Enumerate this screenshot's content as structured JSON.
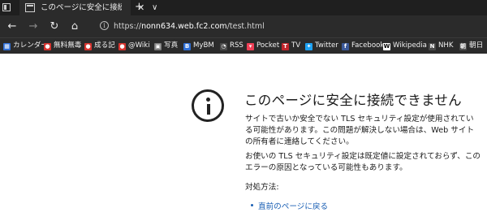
{
  "tab": {
    "title": "このページに安全に接続できま",
    "close": "✕"
  },
  "tabstrip": {
    "new_tab": "+",
    "tab_list": "∨"
  },
  "nav": {
    "back": "←",
    "forward": "→",
    "refresh": "↻",
    "home": "⌂"
  },
  "address": {
    "scheme": "https://",
    "host": "nonn634.web.fc2.com",
    "path": "/test.html"
  },
  "favorites": [
    {
      "label": "カレンダー",
      "icon": "calendar-icon",
      "color": "#2f6fd6"
    },
    {
      "label": "無料無毒",
      "icon": "site-icon",
      "color": "#d6342f"
    },
    {
      "label": "成る記",
      "icon": "site-icon",
      "color": "#d6342f"
    },
    {
      "label": "@Wiki",
      "icon": "wiki-icon",
      "color": "#d6342f"
    },
    {
      "label": "写真",
      "icon": "photos-icon",
      "color": "#7a7a7a"
    },
    {
      "label": "MyBM",
      "icon": "bookmark-icon",
      "color": "#2f6fd6"
    },
    {
      "label": "RSS",
      "icon": "rss-icon",
      "color": "#4a4a4a"
    },
    {
      "label": "Pocket",
      "icon": "pocket-icon",
      "color": "#ef3f56"
    },
    {
      "label": "TV",
      "icon": "tv-icon",
      "color": "#c0262d"
    },
    {
      "label": "Twitter",
      "icon": "twitter-icon",
      "color": "#1da1f2"
    },
    {
      "label": "Facebook",
      "icon": "facebook-icon",
      "color": "#3b5998"
    },
    {
      "label": "Wikipedia",
      "icon": "wikipedia-icon",
      "color": "#ffffff"
    },
    {
      "label": "NHK",
      "icon": "nhk-icon",
      "color": "#4a4a4a"
    },
    {
      "label": "朝日",
      "icon": "asahi-icon",
      "color": "#4a4a4a"
    }
  ],
  "error": {
    "headline": "このページに安全に接続できません",
    "para1": "サイトで古いか安全でない TLS セキュリティ設定が使用されている可能性があります。この問題が解決しない場合は、Web サイトの所有者に連絡してください。",
    "para2": "お使いの TLS セキュリティ設定は既定値に設定されておらず、このエラーの原因となっている可能性もあります。",
    "fix_label": "対処方法:",
    "back_link": "直前のページに戻る"
  }
}
